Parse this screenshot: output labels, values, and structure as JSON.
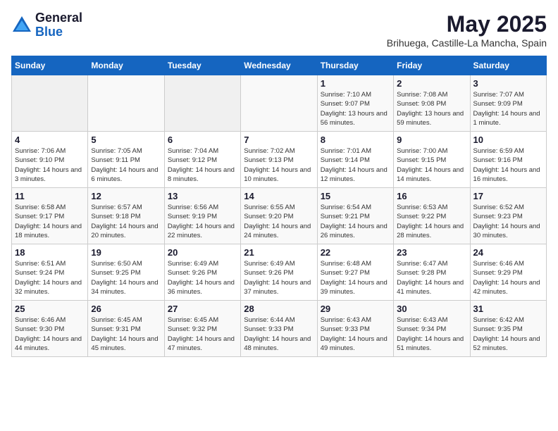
{
  "logo": {
    "general": "General",
    "blue": "Blue"
  },
  "title": "May 2025",
  "location": "Brihuega, Castille-La Mancha, Spain",
  "days_of_week": [
    "Sunday",
    "Monday",
    "Tuesday",
    "Wednesday",
    "Thursday",
    "Friday",
    "Saturday"
  ],
  "weeks": [
    [
      {
        "num": "",
        "sunrise": "",
        "sunset": "",
        "daylight": ""
      },
      {
        "num": "",
        "sunrise": "",
        "sunset": "",
        "daylight": ""
      },
      {
        "num": "",
        "sunrise": "",
        "sunset": "",
        "daylight": ""
      },
      {
        "num": "",
        "sunrise": "",
        "sunset": "",
        "daylight": ""
      },
      {
        "num": "1",
        "sunrise": "Sunrise: 7:10 AM",
        "sunset": "Sunset: 9:07 PM",
        "daylight": "Daylight: 13 hours and 56 minutes."
      },
      {
        "num": "2",
        "sunrise": "Sunrise: 7:08 AM",
        "sunset": "Sunset: 9:08 PM",
        "daylight": "Daylight: 13 hours and 59 minutes."
      },
      {
        "num": "3",
        "sunrise": "Sunrise: 7:07 AM",
        "sunset": "Sunset: 9:09 PM",
        "daylight": "Daylight: 14 hours and 1 minute."
      }
    ],
    [
      {
        "num": "4",
        "sunrise": "Sunrise: 7:06 AM",
        "sunset": "Sunset: 9:10 PM",
        "daylight": "Daylight: 14 hours and 3 minutes."
      },
      {
        "num": "5",
        "sunrise": "Sunrise: 7:05 AM",
        "sunset": "Sunset: 9:11 PM",
        "daylight": "Daylight: 14 hours and 6 minutes."
      },
      {
        "num": "6",
        "sunrise": "Sunrise: 7:04 AM",
        "sunset": "Sunset: 9:12 PM",
        "daylight": "Daylight: 14 hours and 8 minutes."
      },
      {
        "num": "7",
        "sunrise": "Sunrise: 7:02 AM",
        "sunset": "Sunset: 9:13 PM",
        "daylight": "Daylight: 14 hours and 10 minutes."
      },
      {
        "num": "8",
        "sunrise": "Sunrise: 7:01 AM",
        "sunset": "Sunset: 9:14 PM",
        "daylight": "Daylight: 14 hours and 12 minutes."
      },
      {
        "num": "9",
        "sunrise": "Sunrise: 7:00 AM",
        "sunset": "Sunset: 9:15 PM",
        "daylight": "Daylight: 14 hours and 14 minutes."
      },
      {
        "num": "10",
        "sunrise": "Sunrise: 6:59 AM",
        "sunset": "Sunset: 9:16 PM",
        "daylight": "Daylight: 14 hours and 16 minutes."
      }
    ],
    [
      {
        "num": "11",
        "sunrise": "Sunrise: 6:58 AM",
        "sunset": "Sunset: 9:17 PM",
        "daylight": "Daylight: 14 hours and 18 minutes."
      },
      {
        "num": "12",
        "sunrise": "Sunrise: 6:57 AM",
        "sunset": "Sunset: 9:18 PM",
        "daylight": "Daylight: 14 hours and 20 minutes."
      },
      {
        "num": "13",
        "sunrise": "Sunrise: 6:56 AM",
        "sunset": "Sunset: 9:19 PM",
        "daylight": "Daylight: 14 hours and 22 minutes."
      },
      {
        "num": "14",
        "sunrise": "Sunrise: 6:55 AM",
        "sunset": "Sunset: 9:20 PM",
        "daylight": "Daylight: 14 hours and 24 minutes."
      },
      {
        "num": "15",
        "sunrise": "Sunrise: 6:54 AM",
        "sunset": "Sunset: 9:21 PM",
        "daylight": "Daylight: 14 hours and 26 minutes."
      },
      {
        "num": "16",
        "sunrise": "Sunrise: 6:53 AM",
        "sunset": "Sunset: 9:22 PM",
        "daylight": "Daylight: 14 hours and 28 minutes."
      },
      {
        "num": "17",
        "sunrise": "Sunrise: 6:52 AM",
        "sunset": "Sunset: 9:23 PM",
        "daylight": "Daylight: 14 hours and 30 minutes."
      }
    ],
    [
      {
        "num": "18",
        "sunrise": "Sunrise: 6:51 AM",
        "sunset": "Sunset: 9:24 PM",
        "daylight": "Daylight: 14 hours and 32 minutes."
      },
      {
        "num": "19",
        "sunrise": "Sunrise: 6:50 AM",
        "sunset": "Sunset: 9:25 PM",
        "daylight": "Daylight: 14 hours and 34 minutes."
      },
      {
        "num": "20",
        "sunrise": "Sunrise: 6:49 AM",
        "sunset": "Sunset: 9:26 PM",
        "daylight": "Daylight: 14 hours and 36 minutes."
      },
      {
        "num": "21",
        "sunrise": "Sunrise: 6:49 AM",
        "sunset": "Sunset: 9:26 PM",
        "daylight": "Daylight: 14 hours and 37 minutes."
      },
      {
        "num": "22",
        "sunrise": "Sunrise: 6:48 AM",
        "sunset": "Sunset: 9:27 PM",
        "daylight": "Daylight: 14 hours and 39 minutes."
      },
      {
        "num": "23",
        "sunrise": "Sunrise: 6:47 AM",
        "sunset": "Sunset: 9:28 PM",
        "daylight": "Daylight: 14 hours and 41 minutes."
      },
      {
        "num": "24",
        "sunrise": "Sunrise: 6:46 AM",
        "sunset": "Sunset: 9:29 PM",
        "daylight": "Daylight: 14 hours and 42 minutes."
      }
    ],
    [
      {
        "num": "25",
        "sunrise": "Sunrise: 6:46 AM",
        "sunset": "Sunset: 9:30 PM",
        "daylight": "Daylight: 14 hours and 44 minutes."
      },
      {
        "num": "26",
        "sunrise": "Sunrise: 6:45 AM",
        "sunset": "Sunset: 9:31 PM",
        "daylight": "Daylight: 14 hours and 45 minutes."
      },
      {
        "num": "27",
        "sunrise": "Sunrise: 6:45 AM",
        "sunset": "Sunset: 9:32 PM",
        "daylight": "Daylight: 14 hours and 47 minutes."
      },
      {
        "num": "28",
        "sunrise": "Sunrise: 6:44 AM",
        "sunset": "Sunset: 9:33 PM",
        "daylight": "Daylight: 14 hours and 48 minutes."
      },
      {
        "num": "29",
        "sunrise": "Sunrise: 6:43 AM",
        "sunset": "Sunset: 9:33 PM",
        "daylight": "Daylight: 14 hours and 49 minutes."
      },
      {
        "num": "30",
        "sunrise": "Sunrise: 6:43 AM",
        "sunset": "Sunset: 9:34 PM",
        "daylight": "Daylight: 14 hours and 51 minutes."
      },
      {
        "num": "31",
        "sunrise": "Sunrise: 6:42 AM",
        "sunset": "Sunset: 9:35 PM",
        "daylight": "Daylight: 14 hours and 52 minutes."
      }
    ]
  ]
}
